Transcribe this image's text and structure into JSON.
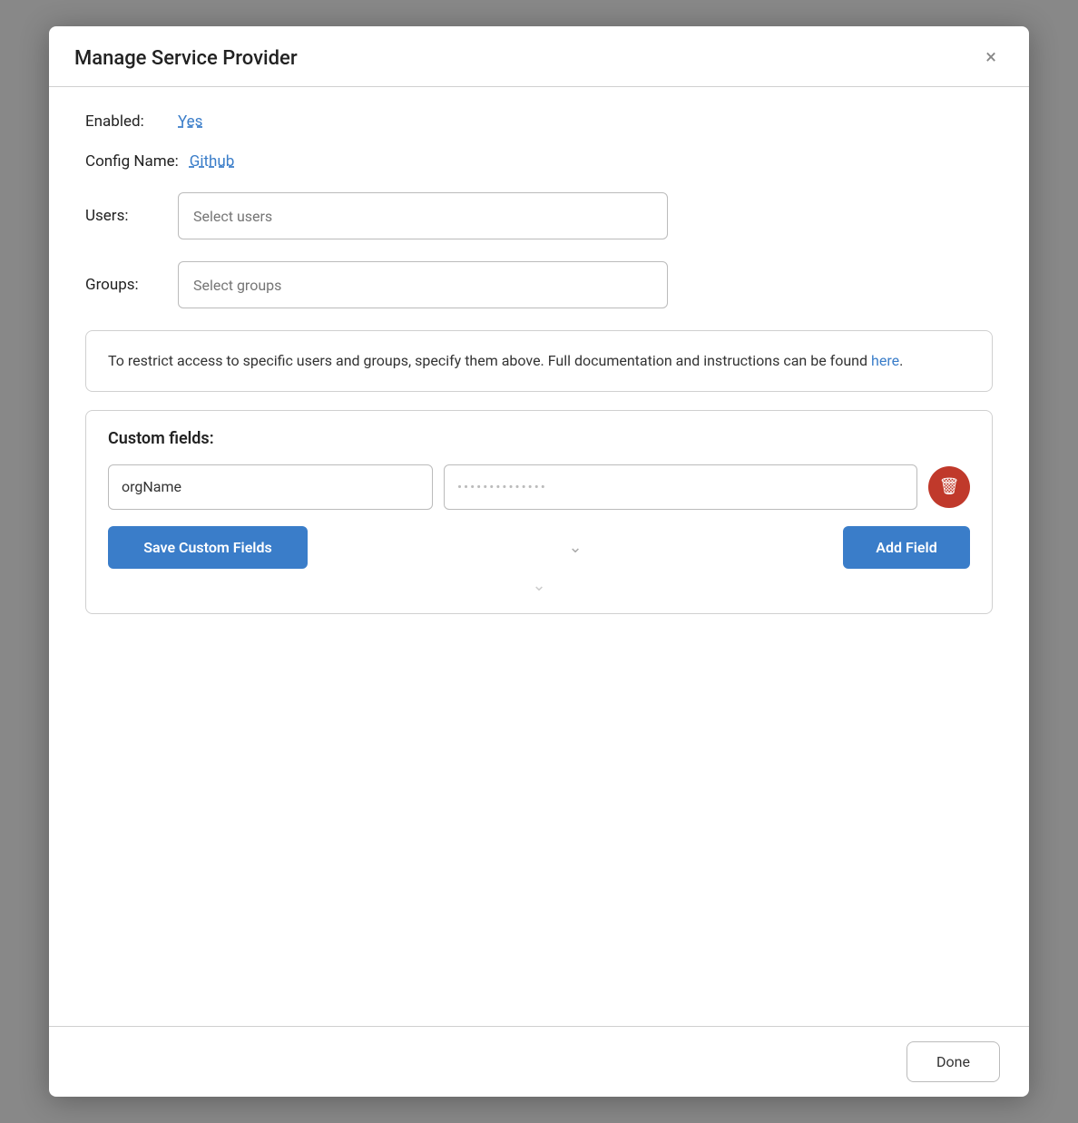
{
  "modal": {
    "title": "Manage Service Provider",
    "close_label": "×"
  },
  "fields": {
    "enabled_label": "Enabled:",
    "enabled_value": "Yes",
    "config_label": "Config Name:",
    "config_value": "Github",
    "users_label": "Users:",
    "users_placeholder": "Select users",
    "groups_label": "Groups:",
    "groups_placeholder": "Select groups"
  },
  "info_box": {
    "text_before": "To restrict access to specific users and groups, specify them above. Full documentation and instructions can be found ",
    "link_text": "here",
    "text_after": "."
  },
  "custom_fields": {
    "title": "Custom fields:",
    "field_name_value": "orgName",
    "field_value_placeholder": "••••••••••••••••••",
    "save_button_label": "Save Custom Fields",
    "add_button_label": "Add Field"
  },
  "footer": {
    "done_label": "Done"
  },
  "icons": {
    "trash": "🗑"
  }
}
